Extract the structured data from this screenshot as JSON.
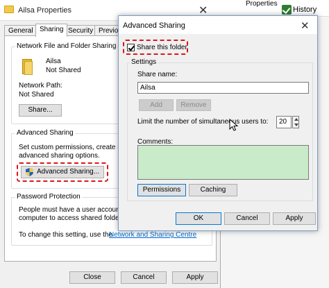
{
  "props": {
    "title": "Ailsa Properties",
    "close_glyph": "✕",
    "tabs": [
      "General",
      "Sharing",
      "Security",
      "Previo"
    ],
    "nff_group_label": "Network File and Folder Sharing",
    "folder_name": "Ailsa",
    "folder_state": "Not Shared",
    "network_path_label": "Network Path:",
    "network_path_value": "Not Shared",
    "share_button": "Share...",
    "advanced_group_label": "Advanced Sharing",
    "advanced_desc_1": "Set custom permissions, create mu",
    "advanced_desc_2": "advanced sharing options.",
    "advanced_button": "Advanced Sharing...",
    "password_group_label": "Password Protection",
    "password_desc_1": "People must have a user account a",
    "password_desc_2": "computer to access shared folders.",
    "password_desc_3": "To change this setting, use the",
    "password_link": "Network and Sharing Centre",
    "close_button": "Close",
    "cancel_button": "Cancel",
    "apply_button": "Apply"
  },
  "strip": {
    "properties": "Properties",
    "history": "History"
  },
  "adv": {
    "title": "Advanced Sharing",
    "close_glyph": "✕",
    "share_checkbox": "Share this folder",
    "settings_label": "Settings",
    "share_name_label": "Share name:",
    "share_name_value": "Ailsa",
    "add_button": "Add",
    "remove_button": "Remove",
    "limit_label": "Limit the number of simultaneous users to:",
    "limit_value": "20",
    "comments_label": "Comments:",
    "permissions_button": "Permissions",
    "caching_button": "Caching",
    "ok_button": "OK",
    "cancel_button": "Cancel",
    "apply_button": "Apply"
  },
  "colors": {
    "highlight": "#d8171a",
    "comments_bg": "#c9ebc9",
    "link": "#0066cc"
  }
}
